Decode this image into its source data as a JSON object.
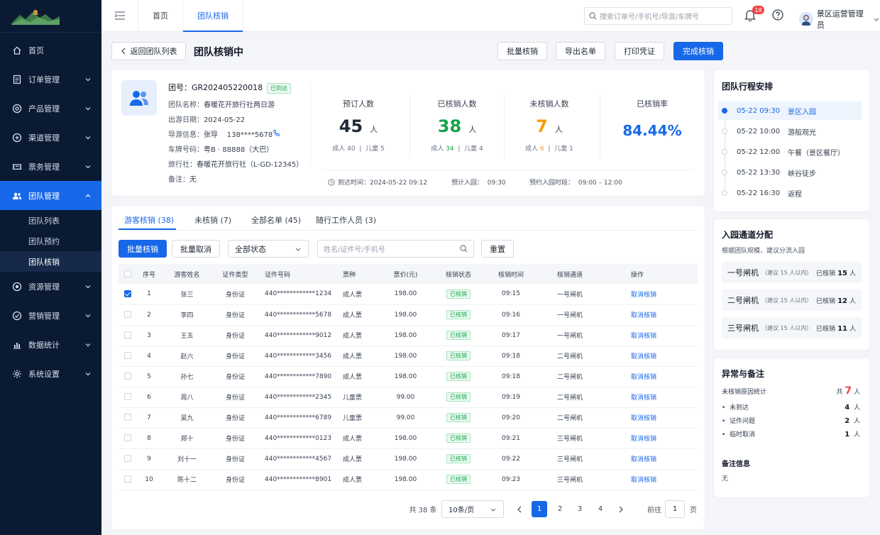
{
  "sidebar": {
    "items": [
      {
        "label": "首页",
        "icon": "home-icon",
        "expandable": false,
        "active": false
      },
      {
        "label": "订单管理",
        "icon": "order-icon",
        "expandable": true,
        "active": false
      },
      {
        "label": "产品管理",
        "icon": "product-icon",
        "expandable": true,
        "active": false
      },
      {
        "label": "渠道管理",
        "icon": "channel-icon",
        "expandable": true,
        "active": false
      },
      {
        "label": "票务管理",
        "icon": "ticket-icon",
        "expandable": true,
        "active": false
      },
      {
        "label": "团队管理",
        "icon": "team-icon",
        "expandable": true,
        "active": true
      },
      {
        "label": "资源管理",
        "icon": "resource-icon",
        "expandable": true,
        "active": false
      },
      {
        "label": "营销管理",
        "icon": "marketing-icon",
        "expandable": true,
        "active": false
      },
      {
        "label": "数据统计",
        "icon": "stats-icon",
        "expandable": true,
        "active": false
      },
      {
        "label": "系统设置",
        "icon": "settings-icon",
        "expandable": true,
        "active": false
      }
    ],
    "sub_items": [
      "团队列表",
      "团队预约",
      "团队核销"
    ],
    "active_sub": 2
  },
  "topbar": {
    "tabs": [
      "首页",
      "团队核销"
    ],
    "search_placeholder": "搜索订单号/手机号/导游/车牌号",
    "notif_count": "18",
    "user_name": "景区运营管理员"
  },
  "header": {
    "back_label": "返回团队列表",
    "title": "团队核销中",
    "actions": [
      "批量核销",
      "导出名单",
      "打印凭证",
      "完成核销"
    ]
  },
  "group": {
    "id_label": "团号：",
    "id": "GR202405220018",
    "status": "已到达",
    "fields": [
      {
        "label": "团队名称：",
        "value": "春暖花开旅行社两日游"
      },
      {
        "label": "出游日期：",
        "value": "2024-05-22"
      },
      {
        "label": "导游信息：",
        "value": "张导    138****5678"
      },
      {
        "label": "车牌号码：",
        "value": "粤B · 88888（大巴）"
      },
      {
        "label": "旅行社：",
        "value": "春暖花开旅行社（L-GD-12345）"
      },
      {
        "label": "备注：",
        "value": "无"
      }
    ]
  },
  "stats": {
    "booked": {
      "title": "预订人数",
      "value": "45",
      "unit": "人",
      "adult_label": "成人",
      "adult": "40",
      "child_label": "儿童",
      "child": "5"
    },
    "verified": {
      "title": "已核销人数",
      "value": "38",
      "unit": "人",
      "adult_label": "成人",
      "adult": "34",
      "child_label": "儿童",
      "child": "4"
    },
    "pending": {
      "title": "未核销人数",
      "value": "7",
      "unit": "人",
      "adult_label": "成人",
      "adult": "6",
      "child_label": "儿童",
      "child": "1"
    },
    "rate": {
      "title": "已核销率",
      "value": "84.44%"
    },
    "arrival": "到达时间：2024-05-22 09:12",
    "expected": "预计入园：  09:30",
    "window": "预约入园时段：  09:00 – 12:00"
  },
  "tabs": [
    "游客核销 (38)",
    "未核销 (7)",
    "全部名单 (45)",
    "随行工作人员 (3)"
  ],
  "toolbar": {
    "batch_verify": "批量核销",
    "batch_cancel": "批量取消",
    "status_select": "全部状态",
    "search_placeholder": "姓名/证件号/手机号",
    "reset": "重置"
  },
  "table": {
    "columns": [
      "序号",
      "游客姓名",
      "证件类型",
      "证件号码",
      "票种",
      "票价(元)",
      "核销状态",
      "核销时间",
      "核销通道",
      "操作"
    ],
    "rows": [
      {
        "checked": true,
        "no": "1",
        "name": "张三",
        "idtype": "身份证",
        "idno": "440************1234",
        "ticket": "成人票",
        "price": "198.00",
        "status": "已核销",
        "time": "09:15",
        "gate": "一号闸机",
        "action": "取消核销"
      },
      {
        "checked": false,
        "no": "2",
        "name": "李四",
        "idtype": "身份证",
        "idno": "440************5678",
        "ticket": "成人票",
        "price": "198.00",
        "status": "已核销",
        "time": "09:16",
        "gate": "一号闸机",
        "action": "取消核销"
      },
      {
        "checked": false,
        "no": "3",
        "name": "王五",
        "idtype": "身份证",
        "idno": "440************9012",
        "ticket": "成人票",
        "price": "198.00",
        "status": "已核销",
        "time": "09:17",
        "gate": "一号闸机",
        "action": "取消核销"
      },
      {
        "checked": false,
        "no": "4",
        "name": "赵六",
        "idtype": "身份证",
        "idno": "440************3456",
        "ticket": "成人票",
        "price": "198.00",
        "status": "已核销",
        "time": "09:18",
        "gate": "二号闸机",
        "action": "取消核销"
      },
      {
        "checked": false,
        "no": "5",
        "name": "孙七",
        "idtype": "身份证",
        "idno": "440************7890",
        "ticket": "成人票",
        "price": "198.00",
        "status": "已核销",
        "time": "09:18",
        "gate": "二号闸机",
        "action": "取消核销"
      },
      {
        "checked": false,
        "no": "6",
        "name": "周八",
        "idtype": "身份证",
        "idno": "440************2345",
        "ticket": "儿童票",
        "price": "99.00",
        "status": "已核销",
        "time": "09:19",
        "gate": "二号闸机",
        "action": "取消核销"
      },
      {
        "checked": false,
        "no": "7",
        "name": "吴九",
        "idtype": "身份证",
        "idno": "440************6789",
        "ticket": "儿童票",
        "price": "99.00",
        "status": "已核销",
        "time": "09:20",
        "gate": "二号闸机",
        "action": "取消核销"
      },
      {
        "checked": false,
        "no": "8",
        "name": "郑十",
        "idtype": "身份证",
        "idno": "440************0123",
        "ticket": "成人票",
        "price": "198.00",
        "status": "已核销",
        "time": "09:21",
        "gate": "三号闸机",
        "action": "取消核销"
      },
      {
        "checked": false,
        "no": "9",
        "name": "刘十一",
        "idtype": "身份证",
        "idno": "440************4567",
        "ticket": "成人票",
        "price": "198.00",
        "status": "已核销",
        "time": "09:22",
        "gate": "三号闸机",
        "action": "取消核销"
      },
      {
        "checked": false,
        "no": "10",
        "name": "陈十二",
        "idtype": "身份证",
        "idno": "440************8901",
        "ticket": "成人票",
        "price": "198.00",
        "status": "已核销",
        "time": "09:23",
        "gate": "三号闸机",
        "action": "取消核销"
      }
    ]
  },
  "pagination": {
    "total": "共 38 条",
    "page_size": "10条/页",
    "pages": [
      "1",
      "2",
      "3",
      "4"
    ],
    "current": "1",
    "goto_label": "前往",
    "goto_value": "1",
    "page_suffix": "页"
  },
  "itinerary": {
    "title": "团队行程安排",
    "items": [
      {
        "time": "05-22 09:30",
        "event": "景区入园",
        "current": true
      },
      {
        "time": "05-22 10:00",
        "event": "游船观光",
        "current": false
      },
      {
        "time": "05-22 12:00",
        "event": "午餐（景区餐厅）",
        "current": false
      },
      {
        "time": "05-22 13:30",
        "event": "峡谷徒步",
        "current": false
      },
      {
        "time": "05-22 16:30",
        "event": "返程",
        "current": false
      }
    ]
  },
  "gates": {
    "title": "入园通道分配",
    "subtitle": "根据团队规模，建议分流入园",
    "items": [
      {
        "name": "一号闸机",
        "hint": "（建议 15 人以内）",
        "label": "已核销",
        "count": "15",
        "unit": "人"
      },
      {
        "name": "二号闸机",
        "hint": "（建议 15 人以内）",
        "label": "已核销",
        "count": "12",
        "unit": "人"
      },
      {
        "name": "三号闸机",
        "hint": "（建议 15 人以内）",
        "label": "已核销",
        "count": "11",
        "unit": "人"
      }
    ]
  },
  "exceptions": {
    "title": "异常与备注",
    "summary_label": "未核销原因统计",
    "summary_prefix": "共",
    "summary_count": "7",
    "summary_unit": "人",
    "items": [
      {
        "label": "未到达",
        "count": "4",
        "unit": "人"
      },
      {
        "label": "证件问题",
        "count": "2",
        "unit": "人"
      },
      {
        "label": "临时取消",
        "count": "1",
        "unit": "人"
      }
    ],
    "note_title": "备注信息",
    "note": "无"
  },
  "colors": {
    "primary": "#1768e8",
    "sidebar_bg": "#0b1a33",
    "verified_green": "#16a34a",
    "pending_orange": "#f59e0b",
    "badge_red": "#ef4444"
  }
}
